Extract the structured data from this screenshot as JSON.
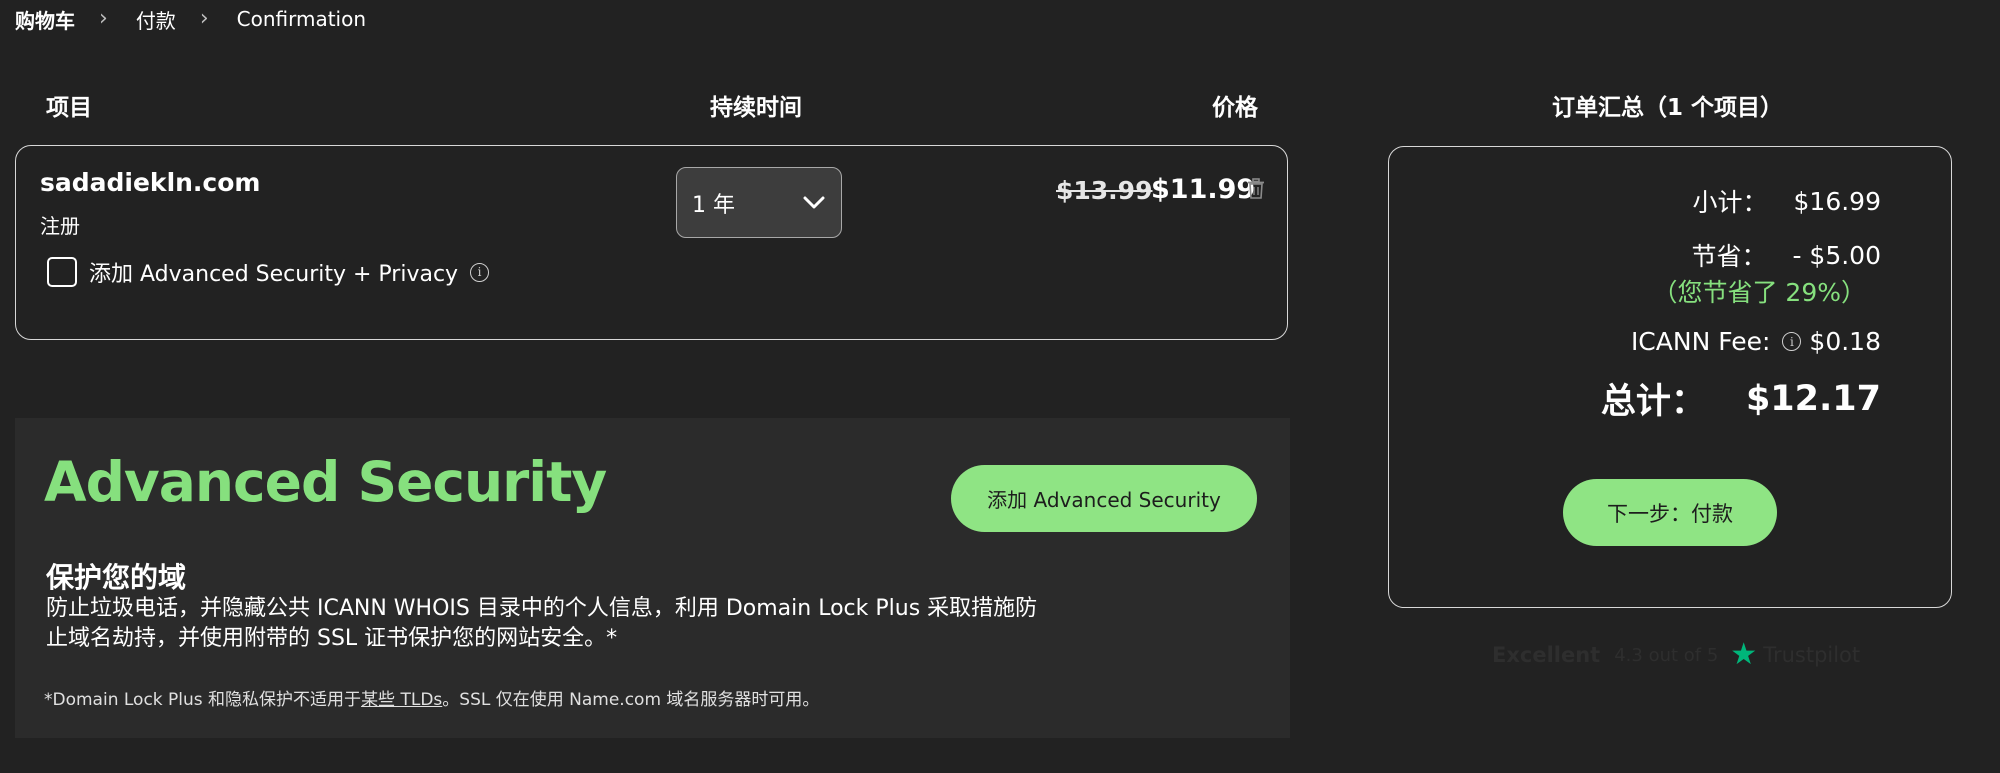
{
  "breadcrumb": {
    "items": [
      "购物车",
      "付款",
      "Confirmation"
    ],
    "separator": "›"
  },
  "cart": {
    "headers": {
      "item": "项目",
      "duration": "持续时间",
      "price": "价格"
    },
    "item": {
      "domain": "sadadiekln.com",
      "type": "注册",
      "addon_label": "添加 Advanced Security + Privacy",
      "addon_checked": false,
      "duration": "1 年",
      "old_price": "$13.99",
      "new_price": "$11.99"
    }
  },
  "advanced_security": {
    "title": "Advanced Security",
    "button": "添加 Advanced Security",
    "subtitle": "保护您的域",
    "description": "防止垃圾电话，并隐藏公共 ICANN WHOIS 目录中的个人信息，利用 Domain Lock Plus 采取措施防止域名劫持，并使用附带的 SSL 证书保护您的网站安全。*",
    "note_prefix": "*Domain Lock Plus 和隐私保护不适用于",
    "note_link": "某些 TLDs",
    "note_suffix": "。SSL 仅在使用 Name.com 域名服务器时可用。"
  },
  "summary": {
    "title": "订单汇总（1 个项目）",
    "subtotal_label": "小计：",
    "subtotal": "$16.99",
    "savings_label": "节省：",
    "savings": "- $5.00",
    "savings_pct": "（您节省了 29%）",
    "icann_label": "ICANN Fee:",
    "icann": "$0.18",
    "total_label": "总计：",
    "total": "$12.17",
    "next_button": "下一步：付款"
  },
  "trustpilot": {
    "rating": "Excellent",
    "score": "4.3 out of 5",
    "brand": "Trustpilot"
  },
  "colors": {
    "background": "#222222",
    "accent": "#86e07e",
    "button": "#8fe484",
    "trustpilot_star": "#00b67a"
  }
}
